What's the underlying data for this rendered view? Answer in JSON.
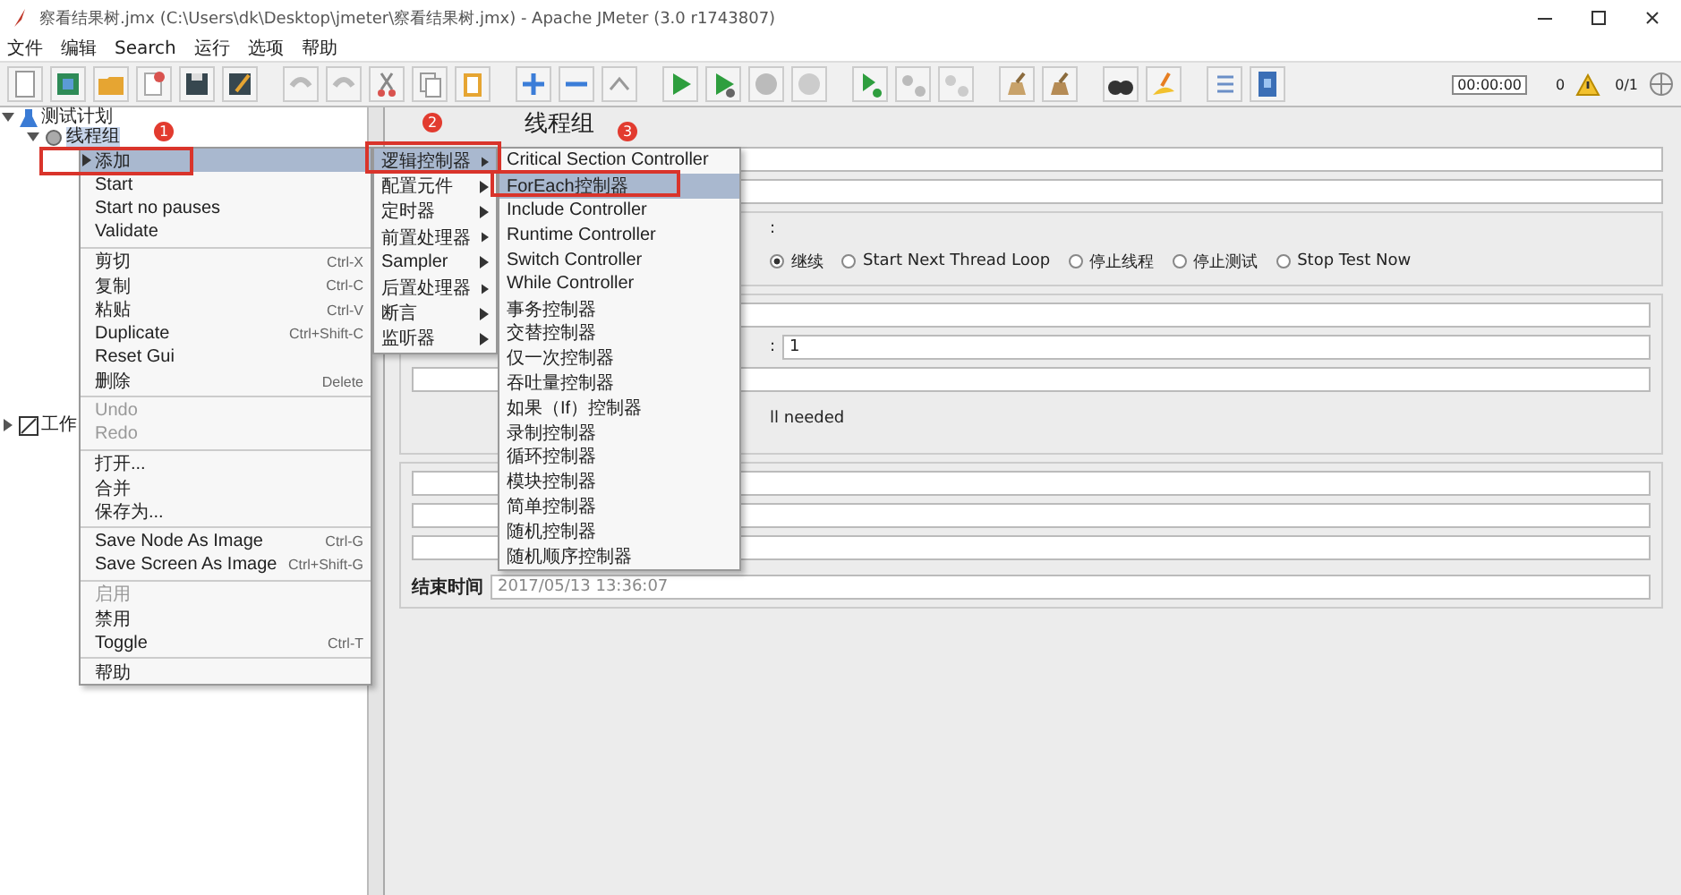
{
  "window": {
    "title": "察看结果树.jmx (C:\\Users\\dk\\Desktop\\jmeter\\察看结果树.jmx) - Apache JMeter (3.0 r1743807)"
  },
  "menu_bar": [
    "文件",
    "编辑",
    "Search",
    "运行",
    "选项",
    "帮助"
  ],
  "toolbar": {
    "timer": "00:00:00",
    "warnings": "0",
    "threads": "0/1"
  },
  "tree": [
    {
      "label": "测试计划",
      "expanded": true,
      "selected": false,
      "children": [
        {
          "label": "线程组",
          "expanded": true,
          "selected": true
        }
      ]
    },
    {
      "label": "工作",
      "expanded": false,
      "selected": false
    }
  ],
  "context_menu": {
    "groups": [
      [
        {
          "label": "添加",
          "submenu": true,
          "selected": true,
          "disabled": false
        },
        {
          "label": "Start",
          "submenu": false,
          "selected": false,
          "disabled": false
        },
        {
          "label": "Start no pauses",
          "submenu": false,
          "selected": false,
          "disabled": false
        },
        {
          "label": "Validate",
          "submenu": false,
          "selected": false,
          "disabled": false
        }
      ],
      [
        {
          "label": "剪切",
          "shortcut": "Ctrl-X",
          "submenu": false,
          "selected": false,
          "disabled": false
        },
        {
          "label": "复制",
          "shortcut": "Ctrl-C",
          "submenu": false,
          "selected": false,
          "disabled": false
        },
        {
          "label": "粘贴",
          "shortcut": "Ctrl-V",
          "submenu": false,
          "selected": false,
          "disabled": false
        },
        {
          "label": "Duplicate",
          "shortcut": "Ctrl+Shift-C",
          "submenu": false,
          "selected": false,
          "disabled": false
        },
        {
          "label": "Reset Gui",
          "submenu": false,
          "selected": false,
          "disabled": false
        },
        {
          "label": "删除",
          "shortcut": "Delete",
          "submenu": false,
          "selected": false,
          "disabled": false
        }
      ],
      [
        {
          "label": "Undo",
          "submenu": false,
          "selected": false,
          "disabled": true
        },
        {
          "label": "Redo",
          "submenu": false,
          "selected": false,
          "disabled": true
        }
      ],
      [
        {
          "label": "打开...",
          "submenu": false,
          "selected": false,
          "disabled": false
        },
        {
          "label": "合并",
          "submenu": false,
          "selected": false,
          "disabled": false
        },
        {
          "label": "保存为...",
          "submenu": false,
          "selected": false,
          "disabled": false
        }
      ],
      [
        {
          "label": "Save Node As Image",
          "shortcut": "Ctrl-G",
          "submenu": false,
          "selected": false,
          "disabled": false
        },
        {
          "label": "Save Screen As Image",
          "shortcut": "Ctrl+Shift-G",
          "submenu": false,
          "selected": false,
          "disabled": false
        }
      ],
      [
        {
          "label": "启用",
          "submenu": false,
          "selected": false,
          "disabled": true
        },
        {
          "label": "禁用",
          "submenu": false,
          "selected": false,
          "disabled": false
        },
        {
          "label": "Toggle",
          "shortcut": "Ctrl-T",
          "submenu": false,
          "selected": false,
          "disabled": false
        }
      ],
      [
        {
          "label": "帮助",
          "submenu": false,
          "selected": false,
          "disabled": false
        }
      ]
    ]
  },
  "add_submenu": [
    {
      "label": "逻辑控制器",
      "selected": true
    },
    {
      "label": "配置元件",
      "selected": false
    },
    {
      "label": "定时器",
      "selected": false
    },
    {
      "label": "前置处理器",
      "selected": false
    },
    {
      "label": "Sampler",
      "selected": false
    },
    {
      "label": "后置处理器",
      "selected": false
    },
    {
      "label": "断言",
      "selected": false
    },
    {
      "label": "监听器",
      "selected": false
    }
  ],
  "controller_submenu": [
    {
      "label": "Critical Section Controller",
      "selected": false
    },
    {
      "label": "ForEach控制器",
      "selected": true
    },
    {
      "label": "Include Controller",
      "selected": false
    },
    {
      "label": "Runtime Controller",
      "selected": false
    },
    {
      "label": "Switch Controller",
      "selected": false
    },
    {
      "label": "While Controller",
      "selected": false
    },
    {
      "label": "事务控制器",
      "selected": false
    },
    {
      "label": "交替控制器",
      "selected": false
    },
    {
      "label": "仅一次控制器",
      "selected": false
    },
    {
      "label": "吞吐量控制器",
      "selected": false
    },
    {
      "label": "如果（If）控制器",
      "selected": false
    },
    {
      "label": "录制控制器",
      "selected": false
    },
    {
      "label": "循环控制器",
      "selected": false
    },
    {
      "label": "模块控制器",
      "selected": false
    },
    {
      "label": "简单控制器",
      "selected": false
    },
    {
      "label": "随机控制器",
      "selected": false
    },
    {
      "label": "随机顺序控制器",
      "selected": false
    }
  ],
  "annotations": [
    {
      "label": "1"
    },
    {
      "label": "2"
    },
    {
      "label": "3"
    }
  ],
  "panel": {
    "title": "线程组",
    "error_label": ":",
    "error_actions": [
      {
        "label": "继续",
        "selected": true
      },
      {
        "label": "Start Next Thread Loop",
        "selected": false
      },
      {
        "label": "停止线程",
        "selected": false
      },
      {
        "label": "停止测试",
        "selected": false
      },
      {
        "label": "Stop Test Now",
        "selected": false
      }
    ],
    "loop_label": ":",
    "loop_value": "1",
    "delay_label": "ll needed",
    "end_time_label": "结束时间",
    "end_time_value": "2017/05/13 13:36:07"
  }
}
